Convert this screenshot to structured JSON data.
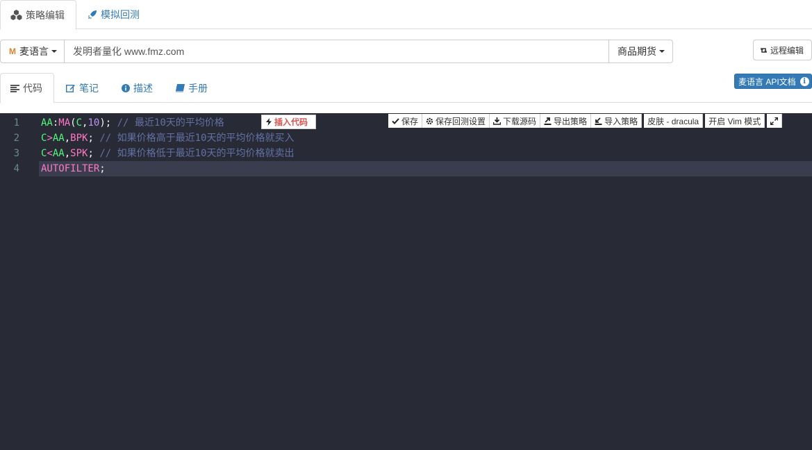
{
  "top_tabs": [
    {
      "label": "策略编辑",
      "icon": "cubes-icon"
    },
    {
      "label": "模拟回测",
      "icon": "rocket-icon"
    }
  ],
  "toolbar": {
    "language": "麦语言",
    "title_value": "发明者量化 www.fmz.com",
    "market": "商品期货",
    "remote_edit": "远程编辑"
  },
  "sub_tabs": [
    {
      "label": "代码",
      "icon": "align-left-icon"
    },
    {
      "label": "笔记",
      "icon": "edit-icon"
    },
    {
      "label": "描述",
      "icon": "info-circle-icon"
    },
    {
      "label": "手册",
      "icon": "book-icon"
    }
  ],
  "api_doc": "麦语言 API文档",
  "editor": {
    "insert_code": "插入代码",
    "buttons": {
      "save": "保存",
      "save_backtest": "保存回测设置",
      "download": "下载源码",
      "export": "导出策略",
      "import": "导入策略",
      "skin": "皮肤 - dracula",
      "vim": "开启 Vim 模式"
    },
    "lines": [
      {
        "num": "1",
        "tokens": [
          [
            "AA",
            "var"
          ],
          [
            ":",
            "op"
          ],
          [
            "MA",
            "fn"
          ],
          [
            "(",
            "op"
          ],
          [
            "C",
            "var"
          ],
          [
            ",",
            "op"
          ],
          [
            "10",
            "num"
          ],
          [
            "); ",
            "op"
          ],
          [
            "// 最近10天的平均价格",
            "cm"
          ]
        ]
      },
      {
        "num": "2",
        "tokens": [
          [
            "C",
            "var"
          ],
          [
            ">",
            "fn"
          ],
          [
            "AA",
            "var"
          ],
          [
            ",",
            "op"
          ],
          [
            "BPK",
            "fn"
          ],
          [
            "; ",
            "op"
          ],
          [
            "// 如果价格高于最近10天的平均价格就买入",
            "cm"
          ]
        ]
      },
      {
        "num": "3",
        "tokens": [
          [
            "C",
            "var"
          ],
          [
            "<",
            "fn"
          ],
          [
            "AA",
            "var"
          ],
          [
            ",",
            "op"
          ],
          [
            "SPK",
            "fn"
          ],
          [
            "; ",
            "op"
          ],
          [
            "// 如果价格低于最近10天的平均价格就卖出",
            "cm"
          ]
        ]
      },
      {
        "num": "4",
        "tokens": [
          [
            "AUTOFILTER",
            "fn"
          ],
          [
            ";",
            "op"
          ]
        ]
      }
    ]
  }
}
